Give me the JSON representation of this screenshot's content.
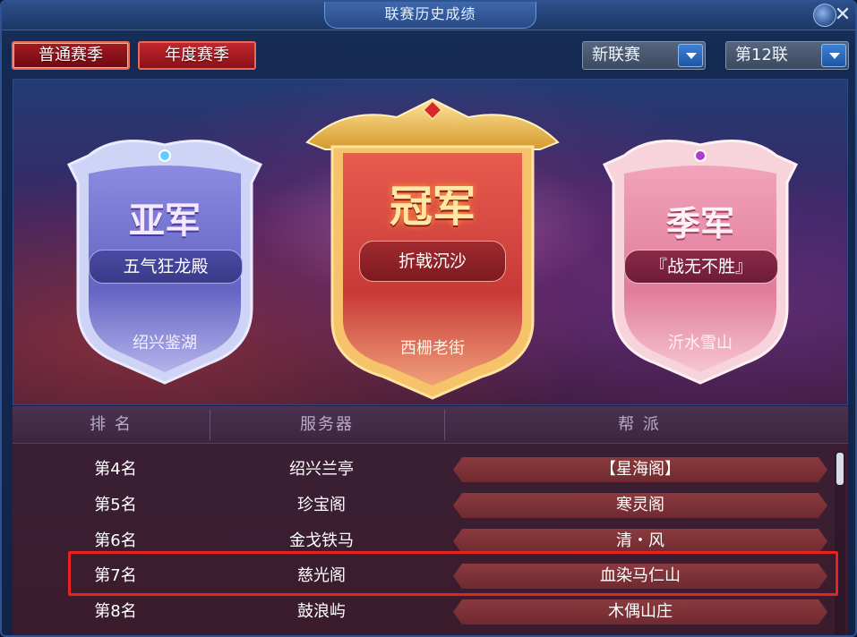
{
  "window": {
    "title": "联赛历史成绩",
    "close_glyph": "✕"
  },
  "tabs": [
    {
      "label": "普通赛季",
      "active": true
    },
    {
      "label": "年度赛季",
      "active": false
    }
  ],
  "filters": {
    "league_type": "新联赛",
    "league_number": "第12联"
  },
  "podium": {
    "second": {
      "title": "亚军",
      "guild": "五气狂龙殿",
      "server": "绍兴鉴湖",
      "color": "#6a68c8"
    },
    "first": {
      "title": "冠军",
      "guild": "折戟沉沙",
      "server": "西栅老街",
      "color": "#d8443e"
    },
    "third": {
      "title": "季军",
      "guild": "『战无不胜』",
      "server": "沂水雪山",
      "color": "#e98aa6"
    }
  },
  "table": {
    "headers": [
      "排 名",
      "服务器",
      "帮 派"
    ],
    "rows": [
      {
        "rank": "第4名",
        "server": "绍兴兰亭",
        "guild": "【星海阁】"
      },
      {
        "rank": "第5名",
        "server": "珍宝阁",
        "guild": "寒灵阁"
      },
      {
        "rank": "第6名",
        "server": "金戈铁马",
        "guild": "清・风"
      },
      {
        "rank": "第7名",
        "server": "慈光阁",
        "guild": "血染马仁山",
        "highlighted": true
      },
      {
        "rank": "第8名",
        "server": "鼓浪屿",
        "guild": "木偶山庄"
      }
    ]
  },
  "colors": {
    "highlight_border": "#e8221f",
    "gold": "#f3c65a"
  }
}
